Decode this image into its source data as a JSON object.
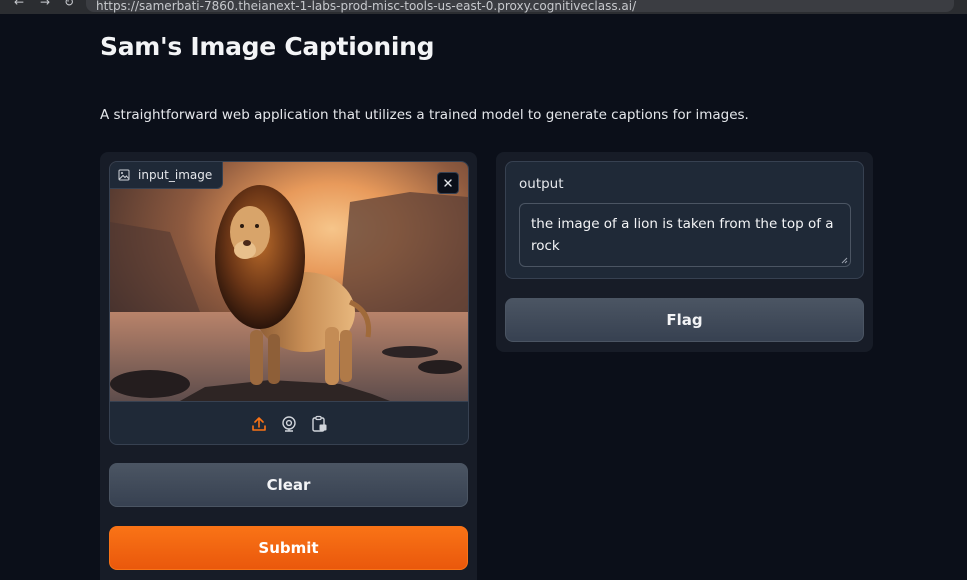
{
  "browser": {
    "back_glyph": "←",
    "forward_glyph": "→",
    "reload_glyph": "↻",
    "url": "https://samerbati-7860.theianext-1-labs-prod-misc-tools-us-east-0.proxy.cognitiveclass.ai/"
  },
  "header": {
    "title": "Sam's Image Captioning",
    "description": "A straightforward web application that utilizes a trained model to generate captions for images."
  },
  "input": {
    "label": "input_image",
    "image_subject": "lion standing on rock at sunset",
    "sources": [
      "upload-icon",
      "webcam-icon",
      "clipboard-icon"
    ]
  },
  "output": {
    "label": "output",
    "value": "the image of a lion is taken from the top of a rock"
  },
  "buttons": {
    "clear": "Clear",
    "submit": "Submit",
    "flag": "Flag"
  },
  "colors": {
    "background": "#0b0f19",
    "panel": "#171c27",
    "block": "#1f2937",
    "border": "#374151",
    "accent": "#f97316"
  }
}
